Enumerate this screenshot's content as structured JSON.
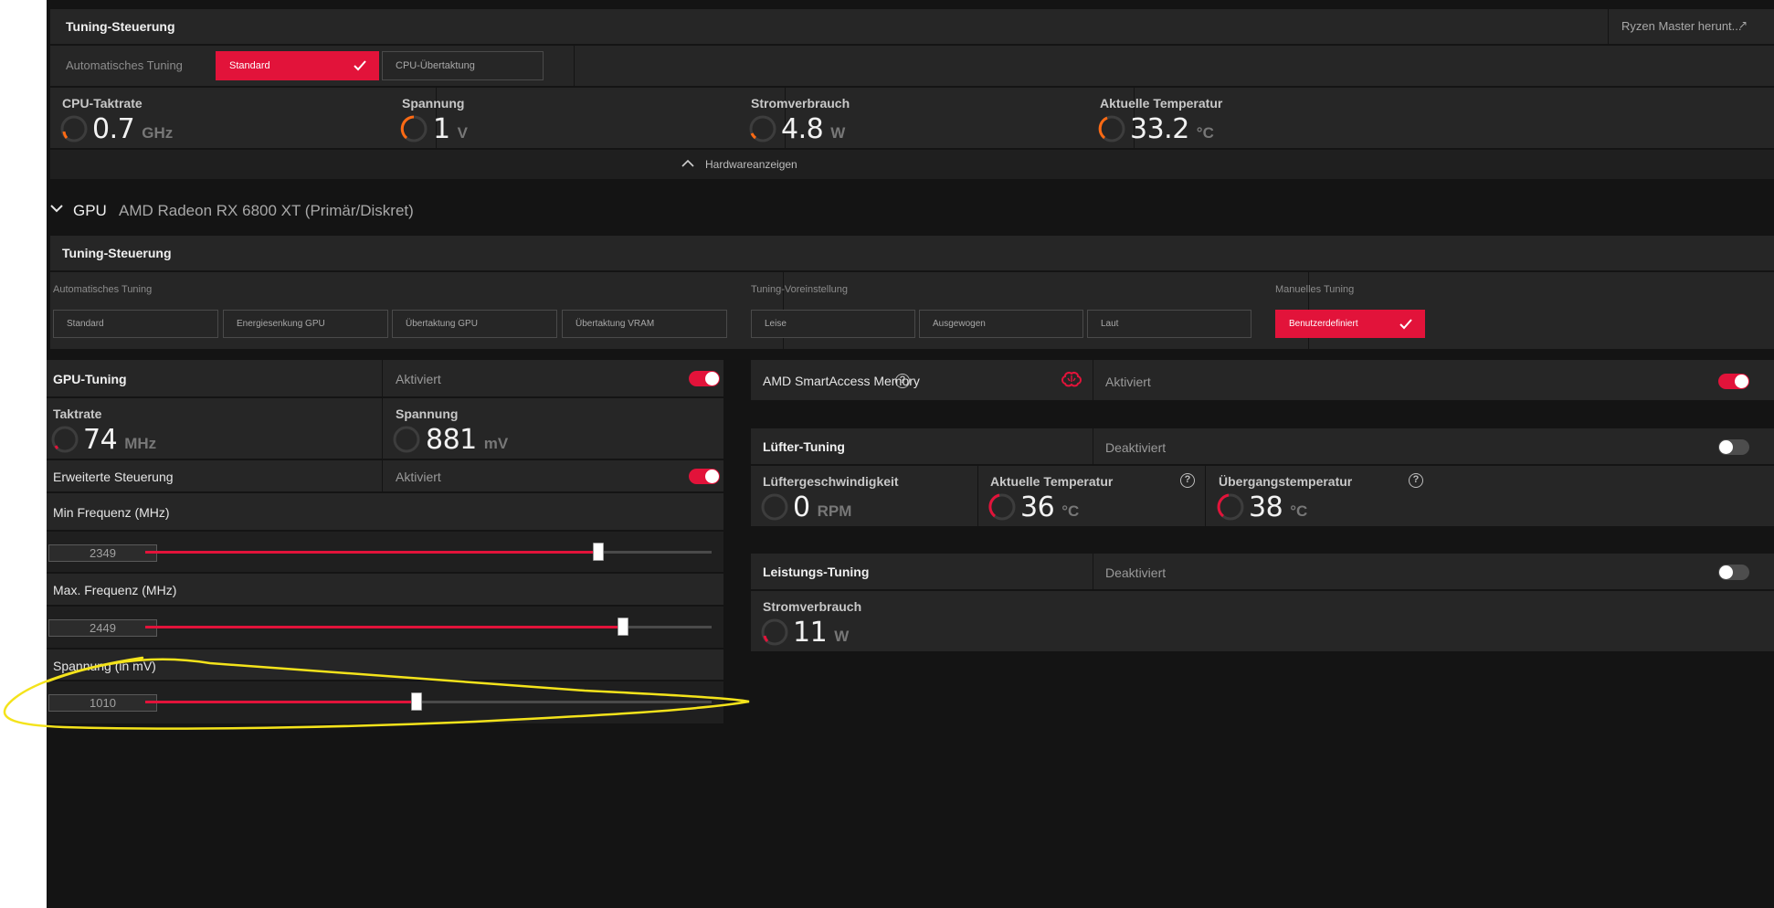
{
  "cpu": {
    "tuning_title": "Tuning-Steuerung",
    "ryzen_link": "Ryzen Master herunt...",
    "auto_tuning_label": "Automatisches Tuning",
    "buttons": {
      "standard": "Standard",
      "overclock": "CPU-Übertaktung"
    },
    "metrics": [
      {
        "label": "CPU-Taktrate",
        "value": "0.7",
        "unit": "GHz"
      },
      {
        "label": "Spannung",
        "value": "1",
        "unit": "V"
      },
      {
        "label": "Stromverbrauch",
        "value": "4.8",
        "unit": "W"
      },
      {
        "label": "Aktuelle Temperatur",
        "value": "33.2",
        "unit": "°C"
      }
    ],
    "hardware_toggle": "Hardwareanzeigen"
  },
  "gpu": {
    "label": "GPU",
    "name": "AMD Radeon RX 6800 XT (Primär/Diskret)",
    "tuning_title": "Tuning-Steuerung",
    "auto_tuning_label": "Automatisches Tuning",
    "auto_buttons": [
      "Standard",
      "Energiesenkung GPU",
      "Übertaktung GPU",
      "Übertaktung VRAM"
    ],
    "preset_label": "Tuning-Voreinstellung",
    "preset_buttons": [
      "Leise",
      "Ausgewogen",
      "Laut"
    ],
    "manual_label": "Manuelles Tuning",
    "manual_button": "Benutzerdefiniert"
  },
  "gpu_tuning": {
    "title": "GPU-Tuning",
    "status": "Aktiviert",
    "enabled": true,
    "clock": {
      "label": "Taktrate",
      "value": "74",
      "unit": "MHz"
    },
    "voltage": {
      "label": "Spannung",
      "value": "881",
      "unit": "mV"
    },
    "advanced": {
      "label": "Erweiterte Steuerung",
      "status": "Aktiviert",
      "enabled": true
    },
    "sliders": [
      {
        "label": "Min Frequenz (MHz)",
        "value": "2349",
        "fraction": 0.8
      },
      {
        "label": "Max. Frequenz (MHz)",
        "value": "2449",
        "fraction": 0.843
      },
      {
        "label": "Spannung (in mV)",
        "value": "1010",
        "fraction": 0.479
      }
    ]
  },
  "smart_access": {
    "label": "AMD SmartAccess Memory",
    "status": "Aktiviert",
    "enabled": true
  },
  "fan_tuning": {
    "title": "Lüfter-Tuning",
    "status": "Deaktiviert",
    "enabled": false,
    "metrics": [
      {
        "label": "Lüftergeschwindigkeit",
        "value": "0",
        "unit": "RPM"
      },
      {
        "label": "Aktuelle Temperatur",
        "value": "36",
        "unit": "°C"
      },
      {
        "label": "Übergangstemperatur",
        "value": "38",
        "unit": "°C"
      }
    ]
  },
  "power_tuning": {
    "title": "Leistungs-Tuning",
    "status": "Deaktiviert",
    "enabled": false,
    "metric": {
      "label": "Stromverbrauch",
      "value": "11",
      "unit": "W"
    }
  },
  "colors": {
    "accent": "#e2133a",
    "gauge_orange": "#ff6a13",
    "annotation": "#f4e31b"
  }
}
